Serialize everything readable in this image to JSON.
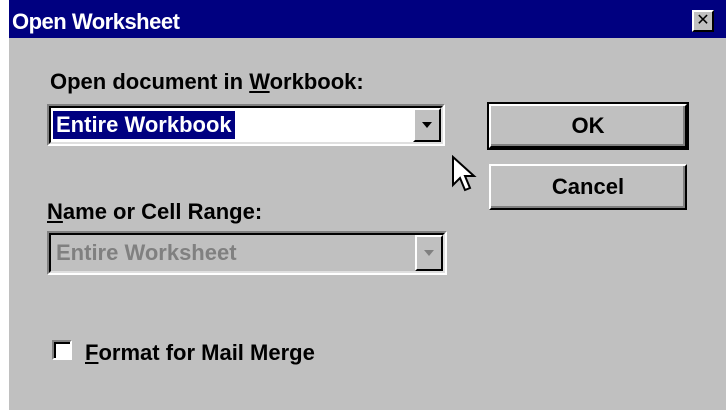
{
  "window": {
    "title": "Open Worksheet",
    "close_glyph": "✕"
  },
  "workbook": {
    "label_prefix": "Open document in ",
    "label_accel": "W",
    "label_suffix": "orkbook:",
    "selected_value": "Entire Workbook"
  },
  "range": {
    "label_accel": "N",
    "label_suffix": "ame or Cell Range:",
    "value": "Entire Worksheet",
    "disabled": true
  },
  "buttons": {
    "ok_label": "OK",
    "cancel_label": "Cancel"
  },
  "mail_merge": {
    "label_accel": "F",
    "label_suffix": "ormat for Mail Merge",
    "checked": false
  },
  "icons": {
    "dropdown": "chevron-down-icon",
    "cursor": "mouse-pointer-icon",
    "close": "close-icon"
  },
  "colors": {
    "titlebar": "#000080",
    "dialog_bg": "#c0c0c0",
    "selection_bg": "#000080",
    "disabled_text": "#808080"
  }
}
